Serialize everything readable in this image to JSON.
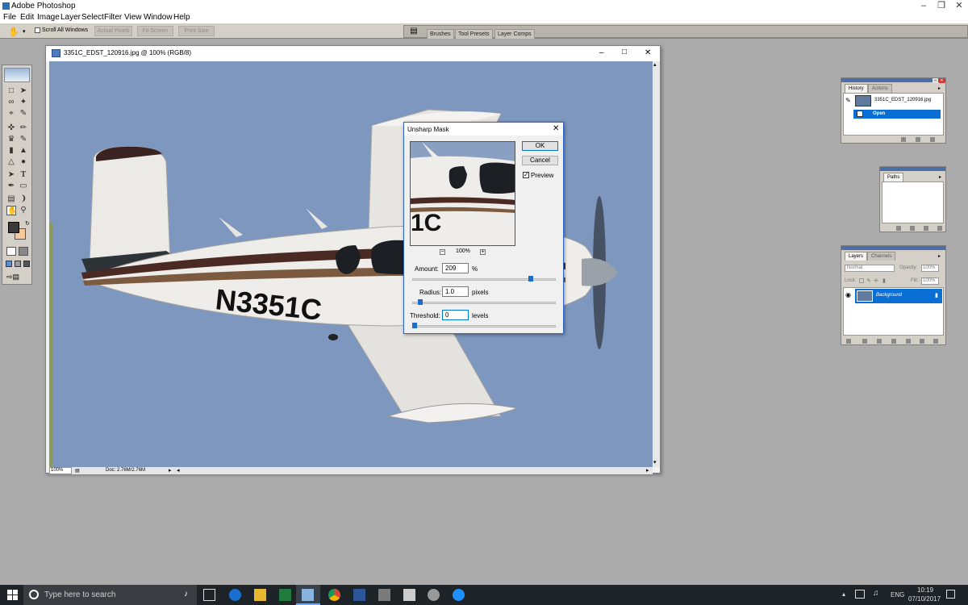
{
  "app": {
    "title": "Adobe Photoshop"
  },
  "menu": [
    "File",
    "Edit",
    "Image",
    "Layer",
    "Select",
    "Filter",
    "View",
    "Window",
    "Help"
  ],
  "options": {
    "scroll_all": "Scroll All Windows",
    "actual_pixels": "Actual Pixels",
    "fit_screen": "Fit Screen",
    "print_size": "Print Size"
  },
  "palette_well": {
    "tabs": [
      "Brushes",
      "Tool Presets",
      "Layer Comps"
    ]
  },
  "document": {
    "title": "3351C_EDST_120916.jpg @ 100% (RGB/8)",
    "zoom": "100%",
    "doc_info": "Doc: 2.76M/2.76M",
    "registration": "N3351C"
  },
  "dialog": {
    "title": "Unsharp Mask",
    "ok": "OK",
    "cancel": "Cancel",
    "preview_label": "Preview",
    "preview_checked": true,
    "preview_zoom": "100%",
    "preview_text": "1C",
    "amount": {
      "label": "Amount:",
      "value": "209",
      "unit": "%",
      "level": 0.84
    },
    "radius": {
      "label": "Radius:",
      "value": "1.0",
      "unit": "pixels",
      "level": 0.04
    },
    "threshold": {
      "label": "Threshold:",
      "value": "0",
      "unit": "levels",
      "level": 0.0
    }
  },
  "history": {
    "tabs": [
      "History",
      "Actions"
    ],
    "snapshot": "3351C_EDST_120916.jpg",
    "item": "Open"
  },
  "paths": {
    "tabs": [
      "Paths"
    ]
  },
  "layers": {
    "tabs": [
      "Layers",
      "Channels"
    ],
    "blend_mode": "Normal",
    "opacity_label": "Opacity:",
    "opacity": "100%",
    "lock_label": "Lock:",
    "fill_label": "Fill:",
    "fill": "100%",
    "layer": "Background"
  },
  "taskbar": {
    "search_placeholder": "Type here to search",
    "lang": "ENG",
    "time": "10:19",
    "date": "07/10/2017"
  },
  "colors": {
    "accent": "#0a6fd4",
    "sky": "#7d97bf"
  }
}
